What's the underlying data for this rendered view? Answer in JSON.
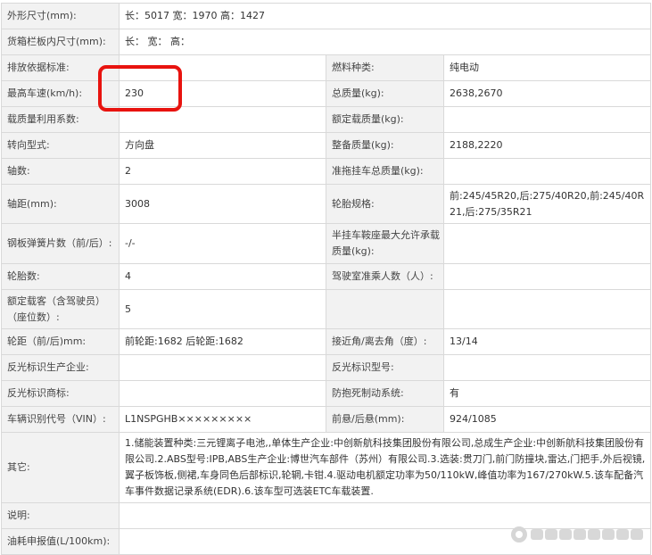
{
  "rows": [
    {
      "l1": "外形尺寸(mm):",
      "v1": "长：5017 宽：1970 高：1427"
    },
    {
      "l1": "货箱栏板内尺寸(mm):",
      "v1": "长：  宽：  高："
    },
    {
      "l1": "排放依据标准:",
      "v1": "",
      "l2": "燃料种类:",
      "v2": "纯电动"
    },
    {
      "l1": "最高车速(km/h):",
      "v1": "230",
      "l2": "总质量(kg):",
      "v2": "2638,2670"
    },
    {
      "l1": "载质量利用系数:",
      "v1": "",
      "l2": "额定载质量(kg):",
      "v2": ""
    },
    {
      "l1": "转向型式:",
      "v1": "方向盘",
      "l2": "整备质量(kg):",
      "v2": "2188,2220"
    },
    {
      "l1": "轴数:",
      "v1": "2",
      "l2": "准拖挂车总质量(kg):",
      "v2": ""
    },
    {
      "l1": "轴距(mm):",
      "v1": "3008",
      "l2": "轮胎规格:",
      "v2": "前:245/45R20,后:275/40R20,前:245/40R21,后:275/35R21"
    },
    {
      "l1": "钢板弹簧片数（前/后）:",
      "v1": "-/-",
      "l2": "半挂车鞍座最大允许承载质量(kg):",
      "v2": ""
    },
    {
      "l1": "轮胎数:",
      "v1": "4",
      "l2": "驾驶室准乘人数（人）:",
      "v2": ""
    },
    {
      "l1": "额定载客（含驾驶员）（座位数）:",
      "v1": "5",
      "l2": "",
      "v2": ""
    },
    {
      "l1": "轮距（前/后)mm:",
      "v1": "前轮距:1682 后轮距:1682",
      "l2": "接近角/离去角（度）:",
      "v2": "13/14"
    },
    {
      "l1": "反光标识生产企业:",
      "v1": "",
      "l2": "反光标识型号:",
      "v2": ""
    },
    {
      "l1": "反光标识商标:",
      "v1": "",
      "l2": "防抱死制动系统:",
      "v2": "有"
    },
    {
      "l1": "车辆识别代号（VIN）:",
      "v1": "L1NSPGHB×××××××××",
      "l2": "前悬/后悬(mm):",
      "v2": "924/1085"
    },
    {
      "l1": "其它:",
      "v1": "1.储能装置种类:三元锂离子电池,,单体生产企业:中创新航科技集团股份有限公司,总成生产企业:中创新航科技集团股份有限公司.2.ABS型号:IPB,ABS生产企业:博世汽车部件（苏州）有限公司.3.选装:贯刀门,前门防撞块,雷达,门把手,外后视镜,翼子板饰板,侧裙,车身同色后部标识,轮辋,卡钳.4.驱动电机额定功率为50/110kW,峰值功率为167/270kW.5.该车配备汽车事件数据记录系统(EDR).6.该车型可选装ETC车载装置."
    },
    {
      "l1": "说明:",
      "v1": ""
    },
    {
      "l1": "油耗申报值(L/100km):",
      "v1": ""
    }
  ],
  "colors": {
    "highlight": "#e8130f",
    "label_bg": "#f2f2f2",
    "border": "#d9d9d9"
  }
}
